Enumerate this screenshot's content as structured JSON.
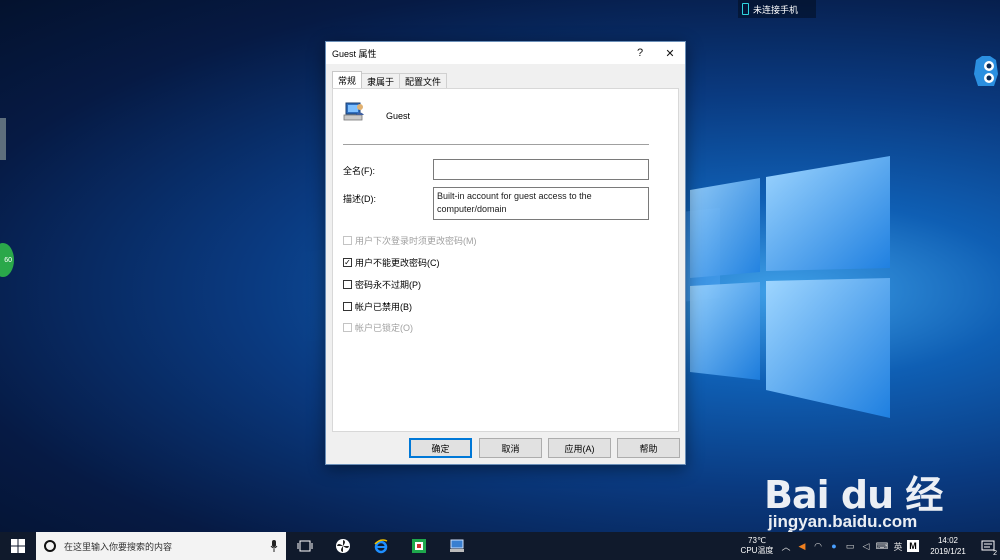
{
  "desktop": {
    "phone_status": "未连接手机",
    "floating_ball": "60"
  },
  "dialog": {
    "title": "Guest 属性",
    "help_glyph": "?",
    "close_glyph": "✕",
    "tabs": [
      {
        "label": "常规",
        "active": true
      },
      {
        "label": "隶属于",
        "active": false
      },
      {
        "label": "配置文件",
        "active": false
      }
    ],
    "user_name": "Guest",
    "full_name_label": "全名(F):",
    "full_name_value": "",
    "description_label": "描述(D):",
    "description_value": "Built-in account for guest access to the computer/domain",
    "checkboxes": [
      {
        "label": "用户下次登录时须更改密码(M)",
        "checked": false,
        "enabled": false
      },
      {
        "label": "用户不能更改密码(C)",
        "checked": true,
        "enabled": true
      },
      {
        "label": "密码永不过期(P)",
        "checked": false,
        "enabled": true
      },
      {
        "label": "帐户已禁用(B)",
        "checked": false,
        "enabled": true
      },
      {
        "label": "帐户已锁定(O)",
        "checked": false,
        "enabled": false
      }
    ],
    "buttons": {
      "ok": "确定",
      "cancel": "取消",
      "apply": "应用(A)",
      "help": "帮助"
    }
  },
  "taskbar": {
    "search_placeholder": "在这里输入你要搜索的内容",
    "cpu_temp": "73℃",
    "cpu_label": "CPU温度",
    "ime_lang": "英",
    "ime_mode": "M",
    "time": "14:02",
    "date": "2019/1/21",
    "notification_count": "2"
  },
  "watermark": {
    "brand": "Bai du 经验",
    "url": "jingyan.baidu.com"
  },
  "colors": {
    "accent": "#0078d7",
    "taskbar": "#101a2c",
    "desktop": "#0a3a80"
  }
}
